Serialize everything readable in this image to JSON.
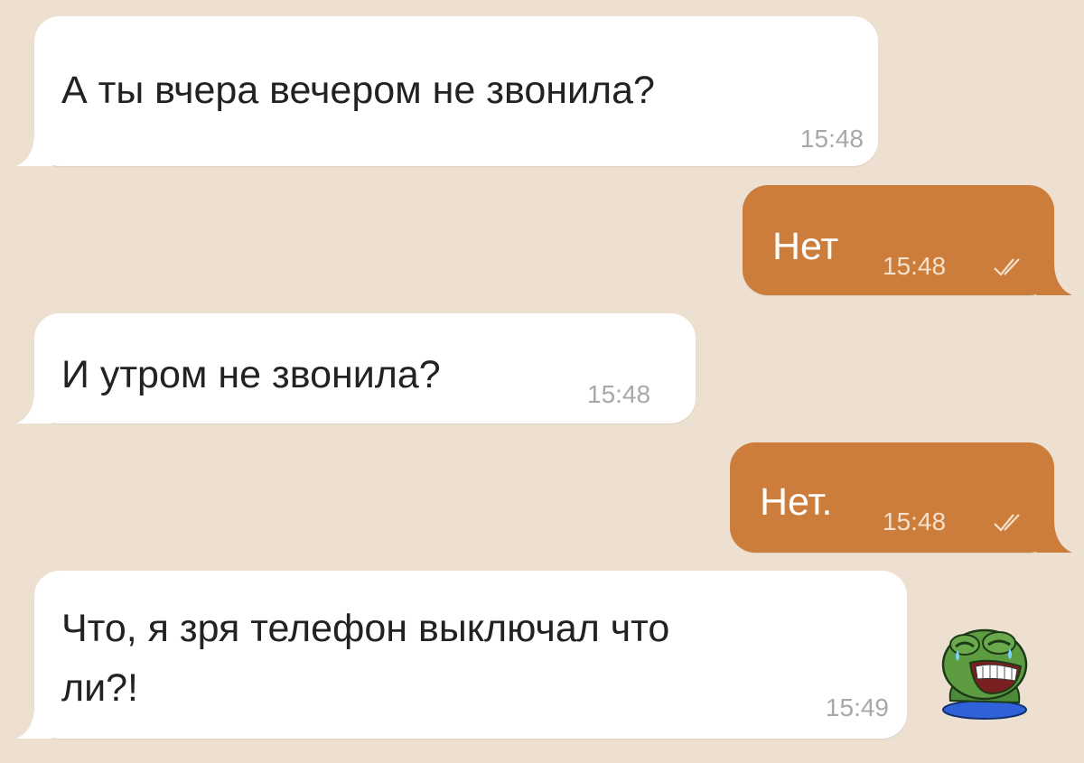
{
  "colors": {
    "background": "#ede0d0",
    "incoming_bubble": "#ffffff",
    "outgoing_bubble": "#cd7d3b",
    "time_incoming": "#a8a8a8",
    "time_outgoing": "#f6e1cc"
  },
  "messages": [
    {
      "direction": "incoming",
      "text": "А ты вчера вечером не звонила?",
      "time": "15:48"
    },
    {
      "direction": "outgoing",
      "text": "Нет",
      "time": "15:48",
      "status_icon": "double-check-icon"
    },
    {
      "direction": "incoming",
      "text": "И утром не звонила?",
      "time": "15:48"
    },
    {
      "direction": "outgoing",
      "text": "Нет.",
      "time": "15:48",
      "status_icon": "double-check-icon"
    },
    {
      "direction": "incoming",
      "text_line1": "Что, я зря телефон выключал что",
      "text_line2": "ли?!",
      "time": "15:49"
    }
  ],
  "sticker": {
    "icon": "laughing-frog-sticker-icon"
  }
}
